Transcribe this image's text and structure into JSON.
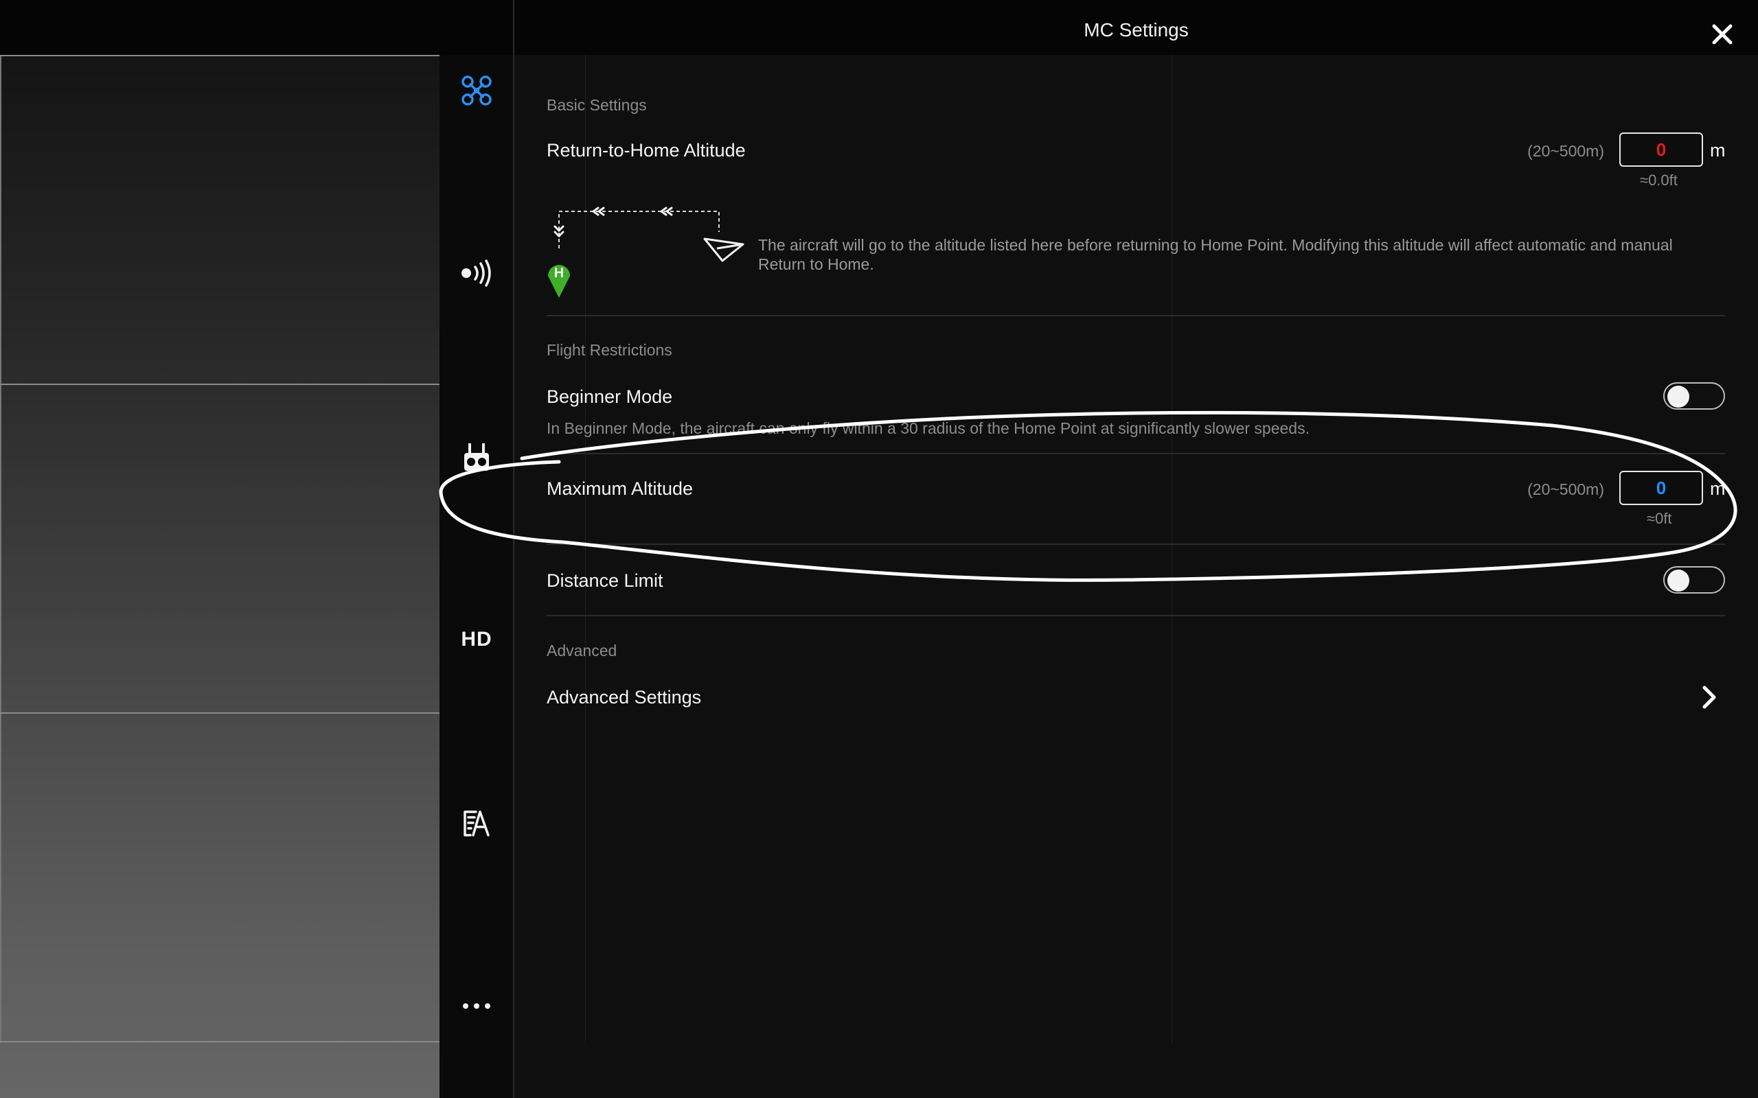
{
  "header": {
    "title": "MC Settings"
  },
  "icons": {
    "close": "close-icon",
    "aircraft": "aircraft-icon",
    "signal": "signal-icon",
    "remote_controller": "remote-controller-icon",
    "hd": "HD",
    "checklist": "checklist-icon",
    "more": "more-icon"
  },
  "colors": {
    "accent": "#1e90ff",
    "warning": "#e01e1e",
    "home_marker": "#3fae29"
  },
  "basic_settings": {
    "section": "Basic Settings",
    "rth_altitude": {
      "label": "Return-to-Home Altitude",
      "range": "(20~500m)",
      "value": "0",
      "unit": "m",
      "approx": "≈0.0ft"
    },
    "home_marker": "H",
    "rth_description": "The aircraft will go to the altitude listed here before returning to Home Point. Modifying this altitude will affect automatic and manual Return to Home."
  },
  "flight_restrictions": {
    "section": "Flight Restrictions",
    "beginner_mode": {
      "label": "Beginner Mode",
      "enabled": false,
      "description": "In Beginner Mode, the aircraft can only fly within a 30 radius of the Home Point at significantly slower speeds."
    },
    "max_altitude": {
      "label": "Maximum Altitude",
      "range": "(20~500m)",
      "value": "0",
      "unit": "m",
      "approx": "≈0ft"
    },
    "distance_limit": {
      "label": "Distance Limit",
      "enabled": false
    }
  },
  "advanced": {
    "section": "Advanced",
    "settings_label": "Advanced Settings"
  }
}
